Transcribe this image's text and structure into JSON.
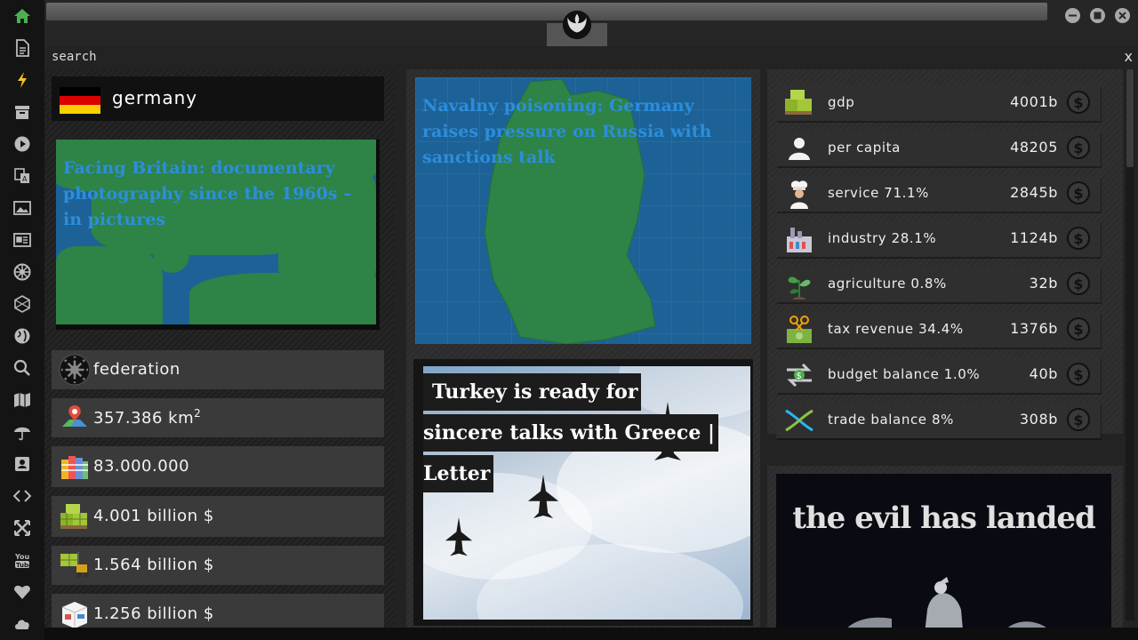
{
  "window": {
    "title_field": "",
    "logo_icon": "rebel-alliance-icon",
    "controls": [
      "minimize-icon",
      "maximize-icon",
      "close-icon"
    ]
  },
  "sidebar": {
    "items": [
      {
        "icon": "home-icon",
        "color": "#4caf50"
      },
      {
        "icon": "document-icon"
      },
      {
        "icon": "lightning-icon",
        "color": "#f5c518"
      },
      {
        "icon": "archive-icon"
      },
      {
        "icon": "play-icon"
      },
      {
        "icon": "translate-icon"
      },
      {
        "icon": "image-icon"
      },
      {
        "icon": "newspaper-icon"
      },
      {
        "icon": "galactic-empire-icon"
      },
      {
        "icon": "hexagon-icon"
      },
      {
        "icon": "globe-icon"
      },
      {
        "icon": "search-icon"
      },
      {
        "icon": "map-icon"
      },
      {
        "icon": "umbrella-icon"
      },
      {
        "icon": "contact-icon"
      },
      {
        "icon": "code-icon"
      },
      {
        "icon": "expand-icon"
      },
      {
        "icon": "youtube-icon"
      },
      {
        "icon": "heart-icon"
      },
      {
        "icon": "cloud-icon"
      }
    ]
  },
  "search": {
    "label": "search",
    "close": "x"
  },
  "country": {
    "name": "germany",
    "flag_colors": [
      "#000000",
      "#dd0000",
      "#ffce00"
    ],
    "map_headline": "Facing Britain: documentary photography since the 1960s – in pictures",
    "info": [
      {
        "icon": "galactic-empire-icon",
        "text": "federation"
      },
      {
        "icon": "map-pin-icon",
        "text": "357.386 km",
        "sup": "2"
      },
      {
        "icon": "population-icon",
        "text": "83.000.000"
      },
      {
        "icon": "money-pallet-icon",
        "text": "4.001 billion $"
      },
      {
        "icon": "money-forklift-icon",
        "text": "1.564 billion $"
      },
      {
        "icon": "package-box-icon",
        "text": "1.256 billion $"
      }
    ]
  },
  "news": {
    "germany_headline": "Navalny poisoning: Germany raises pressure on Russia with sanctions talk",
    "turkey_headline_lines": [
      "Turkey is ready for",
      "sincere talks with Greece |",
      "Letter"
    ]
  },
  "stats": [
    {
      "icon": "money-pallet-icon",
      "label": "gdp",
      "value": "4001b"
    },
    {
      "icon": "person-icon",
      "label": "per capita",
      "value": "48205"
    },
    {
      "icon": "chef-icon",
      "label": "service 71.1%",
      "value": "2845b"
    },
    {
      "icon": "factory-icon",
      "label": "industry 28.1%",
      "value": "1124b"
    },
    {
      "icon": "plant-icon",
      "label": "agriculture 0.8%",
      "value": "32b"
    },
    {
      "icon": "scissors-money-icon",
      "label": "tax revenue 34.4%",
      "value": "1376b"
    },
    {
      "icon": "exchange-arrows-icon",
      "label": "budget balance 1.0%",
      "value": "40b"
    },
    {
      "icon": "trade-cross-icon",
      "label": "trade balance 8%",
      "value": "308b"
    }
  ],
  "dollar_symbol": "$",
  "ad": {
    "title": "the evil has landed"
  }
}
